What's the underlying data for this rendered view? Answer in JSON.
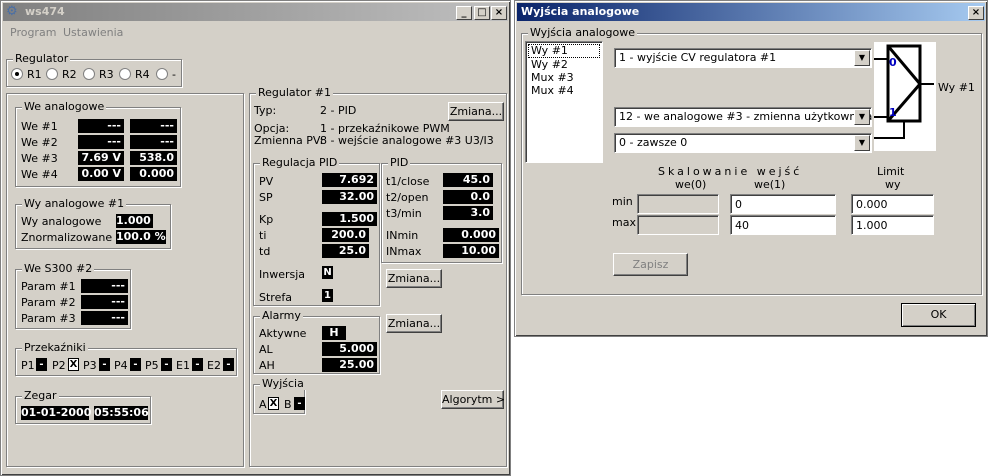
{
  "main": {
    "title": "ws474",
    "menu": [
      "Program",
      "Ustawienia"
    ],
    "regulator_group": {
      "label": "Regulator",
      "options": [
        "R1",
        "R2",
        "R3",
        "R4",
        "-"
      ],
      "selected": 0
    },
    "we_analogowe": {
      "label": "We analogowe",
      "rows": [
        {
          "name": "We #1",
          "v1": "---",
          "v2": "---"
        },
        {
          "name": "We #2",
          "v1": "---",
          "v2": "---"
        },
        {
          "name": "We #3",
          "v1": "7.69 V",
          "v2": "538.0"
        },
        {
          "name": "We #4",
          "v1": "0.00 V",
          "v2": "0.000"
        }
      ]
    },
    "wy_analogowe": {
      "label": "Wy analogowe #1",
      "rows": [
        {
          "name": "Wy analogowe",
          "value": "1.000"
        },
        {
          "name": "Znormalizowane",
          "value": "100.0 %"
        }
      ]
    },
    "we_s300": {
      "label": "We S300 #2",
      "rows": [
        {
          "name": "Param #1",
          "value": "---"
        },
        {
          "name": "Param #2",
          "value": "---"
        },
        {
          "name": "Param #3",
          "value": "---"
        }
      ]
    },
    "przekazniki": {
      "label": "Przekaźniki",
      "items": [
        {
          "name": "P1",
          "state": "-"
        },
        {
          "name": "P2",
          "state": "X"
        },
        {
          "name": "P3",
          "state": "-"
        },
        {
          "name": "P4",
          "state": "-"
        },
        {
          "name": "P5",
          "state": "-"
        },
        {
          "name": "E1",
          "state": "-"
        },
        {
          "name": "E2",
          "state": "-"
        }
      ]
    },
    "zegar": {
      "label": "Zegar",
      "date": "01-01-2000",
      "time": "05:55:06"
    },
    "regulator1": {
      "label": "Regulator #1",
      "typ_label": "Typ:",
      "typ_value": "2 - PID",
      "opcja_label": "Opcja:",
      "opcja_value": "1 - przekaźnikowe PWM",
      "zpv_label": "Zmienna PV:",
      "zpv_value": "8 - wejście analogowe #3 U3/I3",
      "zmiana": "Zmiana...",
      "pid_reg": {
        "label": "Regulacja PID",
        "rows": [
          {
            "name": "PV",
            "value": "7.692"
          },
          {
            "name": "SP",
            "value": "32.00"
          },
          {
            "name": "Kp",
            "value": "1.500"
          },
          {
            "name": "ti",
            "value": "200.0"
          },
          {
            "name": "td",
            "value": "25.0"
          }
        ],
        "inwersja_label": "Inwersja",
        "inwersja": "N",
        "strefa_label": "Strefa",
        "strefa": "1"
      },
      "pid": {
        "label": "PID",
        "rows": [
          {
            "name": "t1/close",
            "value": "45.0"
          },
          {
            "name": "t2/open",
            "value": "0.0"
          },
          {
            "name": "t3/min",
            "value": "3.0"
          },
          {
            "name": "INmin",
            "value": "0.000"
          },
          {
            "name": "INmax",
            "value": "10.00"
          }
        ]
      },
      "alarmy": {
        "label": "Alarmy",
        "rows": [
          {
            "name": "Aktywne",
            "value": "H"
          },
          {
            "name": "AL",
            "value": "5.000"
          },
          {
            "name": "AH",
            "value": "25.00"
          }
        ]
      },
      "wyjscia": {
        "label": "Wyjścia",
        "items": [
          {
            "name": "A",
            "state": "X"
          },
          {
            "name": "B",
            "state": "-"
          }
        ]
      },
      "algorytm": "Algorytm >"
    }
  },
  "dialog": {
    "title": "Wyjścia analogowe",
    "group_label": "Wyjścia analogowe",
    "list": [
      "Wy #1",
      "Wy #2",
      "Mux #3",
      "Mux #4"
    ],
    "list_selected": 0,
    "combo1": "1 - wyjście CV regulatora #1",
    "combo2": "12 - we analogowe #3 - zmienna użytkownika V3",
    "combo3": "0 - zawsze 0",
    "diagram": {
      "in0": "0",
      "in1": "1",
      "out": "Wy #1"
    },
    "skalowanie_label": "Skalowanie wejść",
    "we0_label": "we(0)",
    "we1_label": "we(1)",
    "limit_label": "Limit",
    "wy_label": "wy",
    "min_label": "min",
    "max_label": "max",
    "we1_min": "0",
    "we1_max": "40",
    "limit_min": "0.000",
    "limit_max": "1.000",
    "zapisz": "Zapisz",
    "ok": "OK"
  }
}
